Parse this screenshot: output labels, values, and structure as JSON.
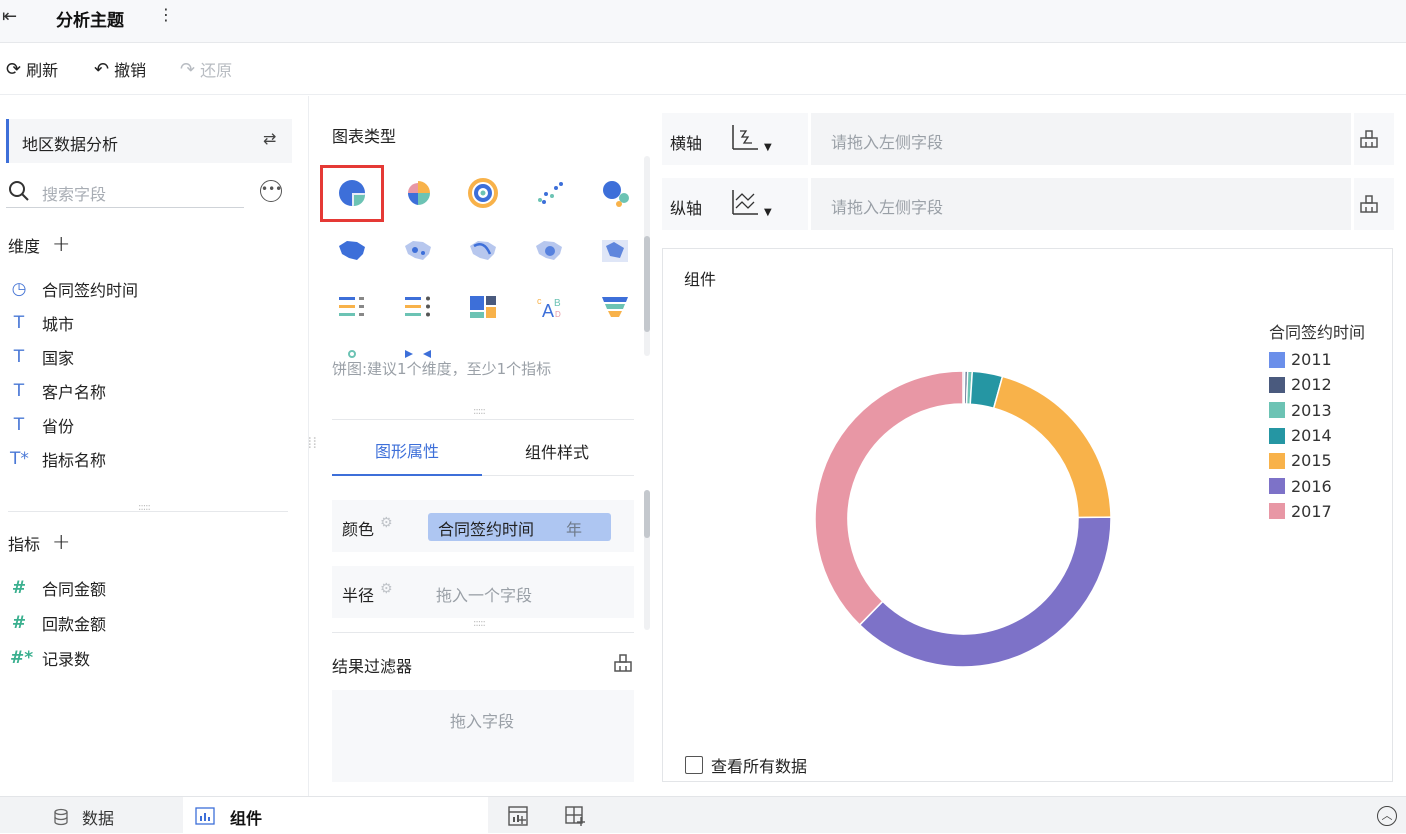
{
  "topbar": {
    "title": "分析主题"
  },
  "toolbar": {
    "refresh": "刷新",
    "undo": "撤销",
    "redo": "还原"
  },
  "left": {
    "dataset_name": "地区数据分析",
    "search_placeholder": "搜索字段",
    "dimensions_label": "维度",
    "dimensions": [
      "合同签约时间",
      "城市",
      "国家",
      "客户名称",
      "省份",
      "指标名称"
    ],
    "measures_label": "指标",
    "measures": [
      "合同金额",
      "回款金额",
      "记录数"
    ]
  },
  "mid": {
    "chart_type_label": "图表类型",
    "hint": "饼图:建议1个维度，至少1个指标",
    "tabs": [
      "图形属性",
      "组件样式"
    ],
    "color_label": "颜色",
    "color_field": "合同签约时间",
    "color_field_unit": "年",
    "radius_label": "半径",
    "radius_placeholder": "拖入一个字段",
    "filter_label": "结果过滤器",
    "filter_placeholder": "拖入字段"
  },
  "right": {
    "x_axis_label": "横轴",
    "y_axis_label": "纵轴",
    "x_placeholder": "请拖入左侧字段",
    "y_placeholder": "请拖入左侧字段",
    "component_title": "组件",
    "show_all_label": "查看所有数据"
  },
  "bottom": {
    "data_tab": "数据",
    "component_tab": "组件"
  },
  "colors": {
    "accent": "#3d6fd9",
    "selected_border": "#e53935"
  },
  "chart_data": {
    "type": "pie",
    "legend_title": "合同签约时间",
    "legend_position": "right",
    "categories": [
      "2011",
      "2012",
      "2013",
      "2014",
      "2015",
      "2016",
      "2017"
    ],
    "values": [
      0.2,
      0.3,
      0.5,
      3.3,
      20.5,
      37.5,
      37.7
    ],
    "colors": [
      "#6b8fea",
      "#4a5a7e",
      "#6cc3b4",
      "#2596a3",
      "#f8b24a",
      "#7d72c8",
      "#e897a5"
    ]
  }
}
